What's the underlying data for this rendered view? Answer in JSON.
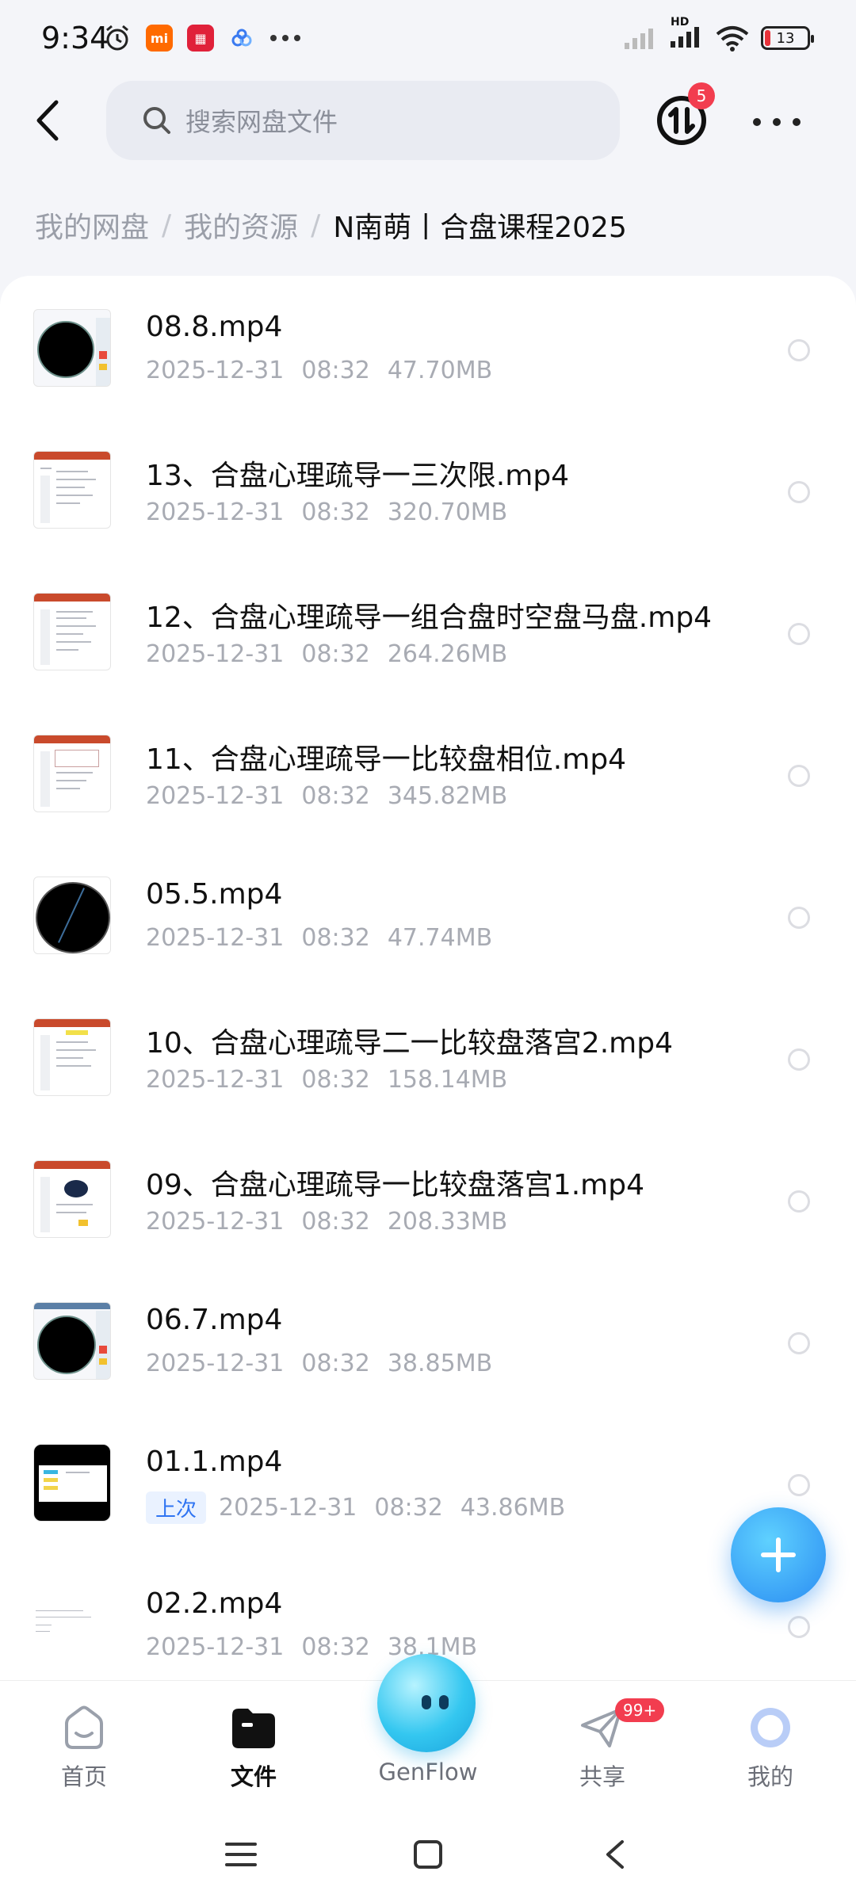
{
  "status_bar": {
    "time": "9:34",
    "battery": "13",
    "battery_level": 0.13,
    "hd_label": "HD"
  },
  "header": {
    "search_placeholder": "搜索网盘文件",
    "transfer_badge": "5"
  },
  "breadcrumb": {
    "items": [
      "我的网盘",
      "我的资源"
    ],
    "current": "N南萌丨合盘课程2025",
    "separator": "/"
  },
  "files": [
    {
      "name": "08.8.mp4",
      "date": "2025-12-31",
      "time": "08:32",
      "size": "47.70MB",
      "thumb": "chart-sidebar"
    },
    {
      "name": "13、合盘心理疏导一三次限.mp4",
      "date": "2025-12-31",
      "time": "08:32",
      "size": "320.70MB",
      "thumb": "document"
    },
    {
      "name": "12、合盘心理疏导一组合盘时空盘马盘.mp4",
      "date": "2025-12-31",
      "time": "08:32",
      "size": "264.26MB",
      "thumb": "document"
    },
    {
      "name": "11、合盘心理疏导一比较盘相位.mp4",
      "date": "2025-12-31",
      "time": "08:32",
      "size": "345.82MB",
      "thumb": "document"
    },
    {
      "name": "05.5.mp4",
      "date": "2025-12-31",
      "time": "08:32",
      "size": "47.74MB",
      "thumb": "chart"
    },
    {
      "name": "10、合盘心理疏导二一比较盘落宫2.mp4",
      "date": "2025-12-31",
      "time": "08:32",
      "size": "158.14MB",
      "thumb": "document"
    },
    {
      "name": "09、合盘心理疏导一比较盘落宫1.mp4",
      "date": "2025-12-31",
      "time": "08:32",
      "size": "208.33MB",
      "thumb": "document-dark"
    },
    {
      "name": "06.7.mp4",
      "date": "2025-12-31",
      "time": "08:32",
      "size": "38.85MB",
      "thumb": "chart-sidebar"
    },
    {
      "name": "01.1.mp4",
      "tag": "上次",
      "date": "2025-12-31",
      "time": "08:32",
      "size": "43.86MB",
      "thumb": "slide"
    },
    {
      "name": "02.2.mp4",
      "date": "2025-12-31",
      "time": "08:32",
      "size": "38.1MB",
      "thumb": "text"
    }
  ],
  "bottom_nav": {
    "items": [
      {
        "label": "首页",
        "icon": "home-icon"
      },
      {
        "label": "文件",
        "icon": "folder-icon"
      },
      {
        "label": "GenFlow",
        "icon": "genflow-orb"
      },
      {
        "label": "共享",
        "icon": "share-icon"
      },
      {
        "label": "我的",
        "icon": "profile-icon"
      }
    ],
    "active": "文件",
    "share_badge": "99+"
  },
  "colors": {
    "accent": "#2a8cf2",
    "badge": "#f23d4f",
    "text_secondary": "#a8abb3"
  }
}
